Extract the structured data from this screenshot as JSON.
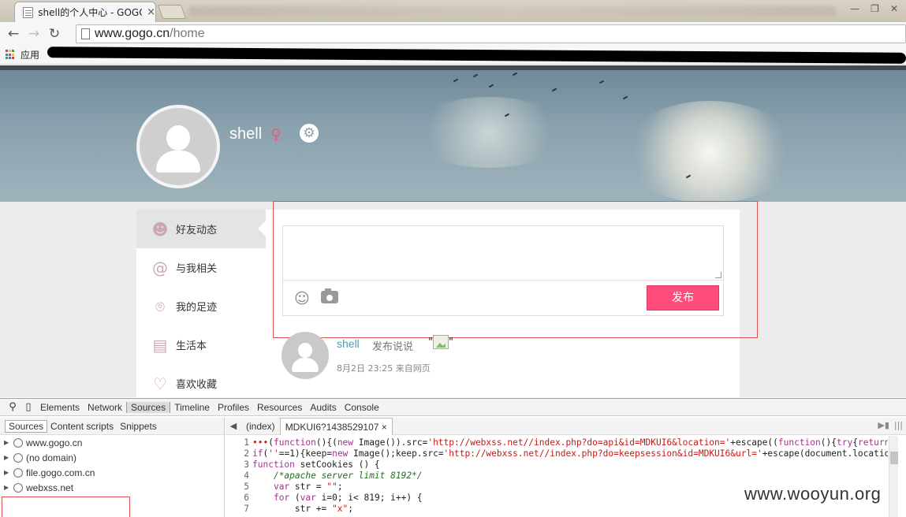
{
  "browser": {
    "tab_title": "shell的个人中心 - GOGO",
    "tab_close": "×",
    "window_controls": [
      "—",
      "❐",
      "✕"
    ],
    "url_host": "www.gogo.cn",
    "url_path": "/home",
    "bookmarks_apps_label": "应用"
  },
  "profile": {
    "username": "shell",
    "gender_symbol": "♀",
    "settings_icon": "⚙"
  },
  "sidebar": {
    "items": [
      {
        "label": "好友动态",
        "icon": "friends-icon",
        "glyph": "👥"
      },
      {
        "label": "与我相关",
        "icon": "at-icon",
        "glyph": "@"
      },
      {
        "label": "我的足迹",
        "icon": "location-pin-icon",
        "glyph": "⌾"
      },
      {
        "label": "生活本",
        "icon": "notebook-icon",
        "glyph": "▤"
      },
      {
        "label": "喜欢收藏",
        "icon": "heart-icon",
        "glyph": "♡"
      }
    ]
  },
  "composer": {
    "textarea_value": "",
    "emoji_glyph": "☺",
    "publish_label": "发布"
  },
  "post": {
    "user": "shell",
    "action": "发布说说",
    "quote_open": "\"",
    "quote_close": "\"",
    "time": "8月2日 23:25 来自网页"
  },
  "devtools": {
    "tabs": [
      "Elements",
      "Network",
      "Sources",
      "Timeline",
      "Profiles",
      "Resources",
      "Audits",
      "Console"
    ],
    "active_tab": "Sources",
    "navigator_tabs": [
      "Sources",
      "Content scripts",
      "Snippets"
    ],
    "tree": [
      "www.gogo.cn",
      "(no domain)",
      "file.gogo.com.cn",
      "webxss.net"
    ],
    "editor_tabs": [
      "(index)",
      "MDKUI6?1438529107"
    ],
    "editor_tab_close": "×",
    "line_numbers": [
      "1",
      "2",
      "3",
      "4",
      "5",
      "6",
      "7"
    ]
  },
  "watermark": "www.wooyun.org",
  "colors": {
    "publish_button": "#ff4c7a",
    "link_blue": "#4d9ab8",
    "highlight_red": "#d9534f"
  }
}
